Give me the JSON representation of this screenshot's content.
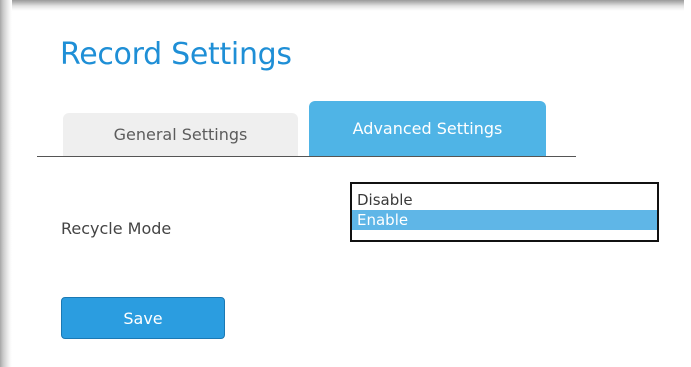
{
  "page": {
    "title": "Record Settings"
  },
  "tabs": [
    {
      "label": "General Settings",
      "active": false
    },
    {
      "label": "Advanced Settings",
      "active": true
    }
  ],
  "form": {
    "recycle_mode": {
      "label": "Recycle Mode",
      "options": [
        "Disable",
        "Enable"
      ],
      "selected": "Enable"
    }
  },
  "actions": {
    "save_label": "Save"
  },
  "colors": {
    "title": "#1f8fd6",
    "active_tab": "#4fb4e6",
    "inactive_tab": "#efefef",
    "selected_option": "#5fb6e7",
    "save_button": "#2b9de0"
  }
}
